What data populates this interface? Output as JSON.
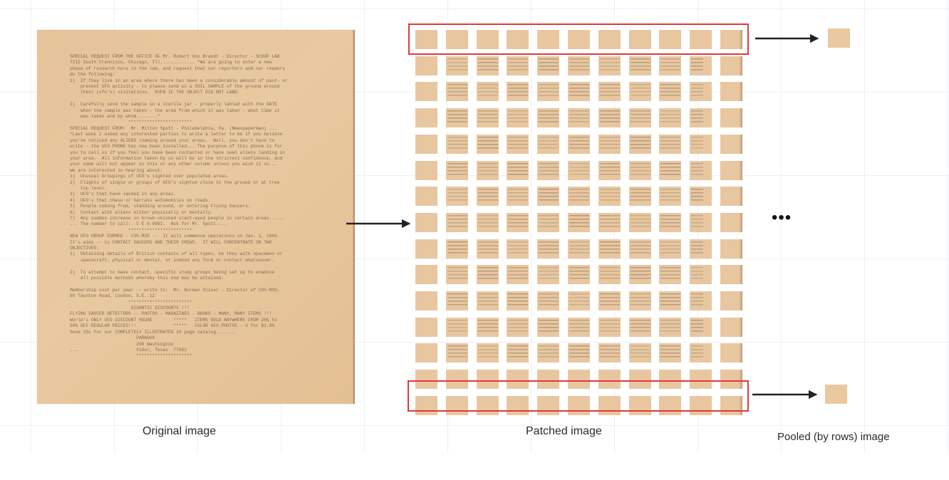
{
  "captions": {
    "original": "Original image",
    "patched": "Patched image",
    "pooled": "Pooled (by rows) image"
  },
  "ellipsis": "•••",
  "grid": {
    "rows": 15,
    "cols": 11,
    "highlighted_rows": [
      1,
      15
    ]
  },
  "colors": {
    "paper": "#e8c7a0",
    "highlight_box": "#e0393b",
    "arrow": "#222222",
    "text_ink": "#6e5d4a"
  },
  "document_text": "SPECIAL REQUEST FROM THE OFFICE OF Mr. Robert Von Brandt - Director - SCOOP LAB\n7212 South Francisco, Chicago, Ill............. \"We are going to enter a new\nphase of research here in the lab, and request that our reporters and our readers\ndo the following:\n1)  If they live in an area where there has been a considerable amount of past- or\n    present UFO activity - to please send us a SOIL SAMPLE of the ground around\n    their (ufo's) visitations.  EVEN IF THE OBJECT DID NOT LAND.\n\n2)  Carefully send the sample in a sterile jar - properly labled with the DATE\n    when the sample was taken - the area from which it was taken - what time it\n    was taken and by whom........\"\n                      ************************\nSPECIAL REQUEST FROM:  Mr. Milton Spott - Philadelphia, Pa. (Newspaperman) ...\n\"Last week I asked any interested parties to write a letter to me if you believe\nyou've noticed any ALIENS roaming around your areas.  Well, you don't have to\nwrite - the UFO PHONE has now been installed... The purpose of this phone is for\nyou to call us if you feel you have been contacted or have seen aliens landing in\nyour area.  All information taken by us will be in the strictest confidence, and\nyour name will not appear in this or any other column unless you wish it so...\nWe are interested in hearing about:\n1)  Unusual Groupings of UFO's sighted over populated areas.\n2)  Flights of single or groups of UFO's sighted close to the ground or at tree\n    top level.\n3)  UFO's that have landed in any areas.\n4)  UFO's that chase or harrass automobiles on roads.\n5)  People coming from, standing around, or entering Flying Saucers.\n6)  Contact with aliens either physically or mentally.\n7)  Any sudden increase in brown-skinned slant-eyed people in certain areas......\n... The number to call:  C E 6-0092.  Ask for Mr. Spott....\n                      ************************\nNEW UFO GROUP FORMED - COS-MOS --  It will commence operations on Jan. 1, 1969.\nIt's aims -- to CONTACT SAUCERS AND THEIR CREWS.  IT WILL CONCENTRATE ON TWO\nOBJECTIVES:\n1)  Obtaining details of British contacts of all types, be they with spacemen or\n    spacecraft, physical or mental, or indeed any form or contact whatsoever.\n\n2)  To attempt to make contact, specific study groups being set up to examine\n    all possible methods whereby this end may be attained.\n\nMembership cost per year -- write to:  Mr. Norman Oliver - Director of COS-MOS.\n95 Taunton Road, London, S.E. 12\n                      ************************\n                       GIGANTIC DISCOUNTS !!!\nFLYING SAUCER DETECTORS -- PHOTOS - MAGAZINES - BOOKS - MANY, MANY ITEMS !!!\nWorld's ONLY UFO DISCOUNT HOUSE        *****   ITEMS SOLD ANYWHERE FROM 25% to\n50% OFF REGULAR PRICES!!!              *****   COLOR UFO PHOTOS - 3 for $1.00\nSend 25c for our COMPLETELY ILLUSTRATED 10 page catalog.......\n                         PARADOX\n                         290 Washington\n...                      Vidor, Texas  77662\n                         *********************"
}
